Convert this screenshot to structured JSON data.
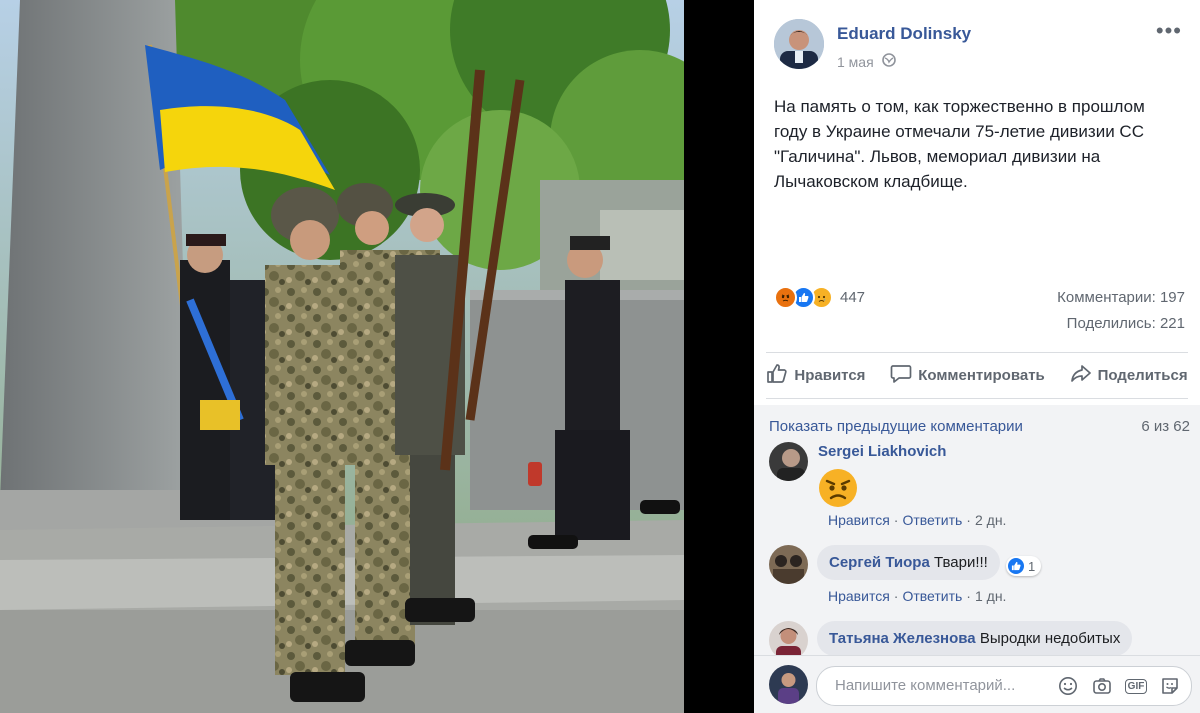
{
  "post": {
    "author": "Eduard Dolinsky",
    "date": "1 мая",
    "privacy_icon": "globe-icon",
    "more_icon": "more-options-icon",
    "text": "На память о том, как торжественно в прошлом году в Украине отмечали 75-летие дивизии СС \"Галичина\". Львов, мемориал дивизии на Лычаковском кладбище."
  },
  "reactions": {
    "types": [
      "angry",
      "like",
      "sad"
    ],
    "count": "447"
  },
  "stats": {
    "comments": "Комментарии: 197",
    "shares": "Поделились: 221"
  },
  "actions": {
    "like": "Нравится",
    "comment": "Комментировать",
    "share": "Поделиться"
  },
  "comments": {
    "show_previous": "Показать предыдущие комментарии",
    "counter": "6 из 62",
    "items": [
      {
        "author": "Sergei Liakhovich",
        "text": "",
        "emoji": "angry-emoji",
        "like": "Нравится",
        "reply": "Ответить",
        "time": "2 дн."
      },
      {
        "author": "Сергей Тиора",
        "text": "Твари!!!",
        "likes": "1",
        "like": "Нравится",
        "reply": "Ответить",
        "time": "1 дн."
      },
      {
        "author": "Татьяна Железнова",
        "text": "Выродки недобитых"
      }
    ]
  },
  "composer": {
    "placeholder": "Напишите комментарий...",
    "icons": [
      "emoji-icon",
      "camera-icon",
      "gif-icon",
      "sticker-icon"
    ]
  },
  "colors": {
    "link": "#385898",
    "secondary": "#606770",
    "like_blue": "#1877f2",
    "angry": "#e9710f",
    "sad": "#f7b125",
    "flag_blue": "#1f5fc0",
    "flag_yellow": "#f5d50c"
  }
}
